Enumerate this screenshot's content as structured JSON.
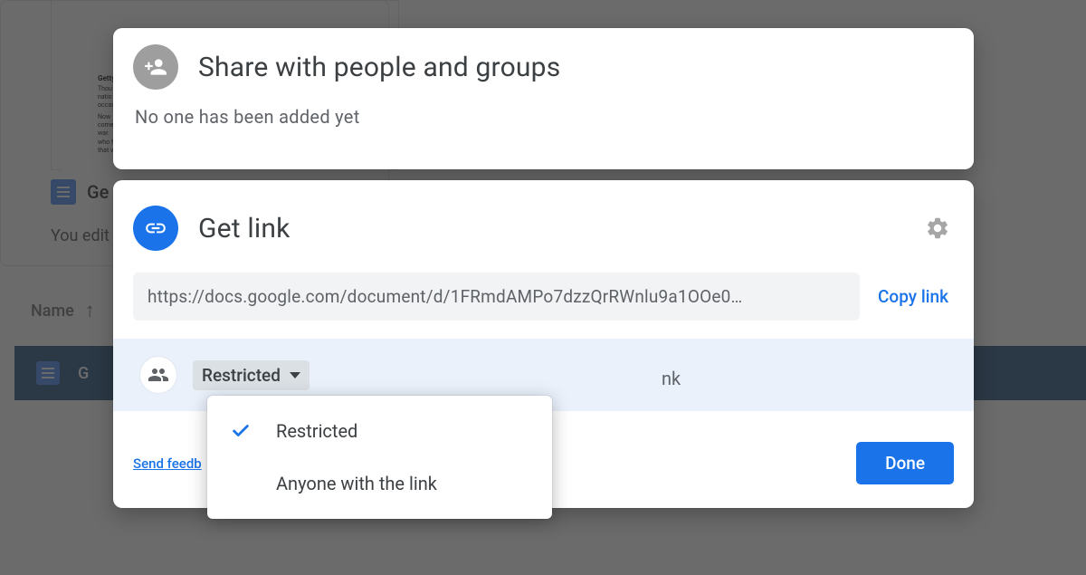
{
  "background": {
    "doc_prefix": "Ge",
    "edited_text": "You edit",
    "name_col": "Name",
    "sel_row_text": "G",
    "thumb_title": "Getty",
    "thumb_line1": "Thou",
    "thumb_line2": "natio",
    "thumb_line3": "occas",
    "thumb_line4": "Now",
    "thumb_line5": "come",
    "thumb_line6": "war.",
    "thumb_line7": "who f",
    "thumb_line8": "that v"
  },
  "share_section": {
    "title": "Share with people and groups",
    "subtitle": "No one has been added yet"
  },
  "link_section": {
    "title": "Get link",
    "url": "https://docs.google.com/document/d/1FRmdAMPo7dzzQrRWnlu9a1OOe0…",
    "copy_label": "Copy link",
    "feedback_label": "Send feedb",
    "done_label": "Done",
    "access_hint_suffix": "nk"
  },
  "access_dropdown": {
    "selected_label": "Restricted",
    "options": [
      {
        "label": "Restricted",
        "checked": true
      },
      {
        "label": "Anyone with the link",
        "checked": false
      }
    ]
  }
}
